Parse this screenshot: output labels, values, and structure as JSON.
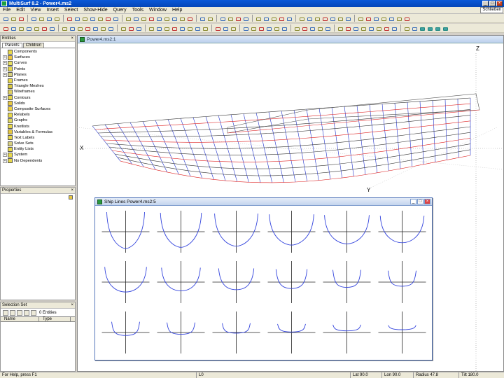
{
  "window": {
    "title": "MultiSurf 8.2 - Power4.ms2",
    "min_label": "_",
    "max_label": "□",
    "close_label": "×"
  },
  "menubar": {
    "items": [
      "File",
      "Edit",
      "View",
      "Insert",
      "Select",
      "Show-Hide",
      "Query",
      "Tools",
      "Window",
      "Help"
    ],
    "close_label": "Schließen"
  },
  "entities_panel": {
    "title": "Entities",
    "close_label": "×",
    "tabs": [
      "Parents",
      "Children"
    ],
    "items": [
      {
        "label": "Components",
        "expander": "",
        "color": "#e8d84a"
      },
      {
        "label": "Surfaces",
        "expander": "+",
        "color": "#f0c840"
      },
      {
        "label": "Curves",
        "expander": "+",
        "color": "#e8e060"
      },
      {
        "label": "Points",
        "expander": "+",
        "color": "#e8d84a"
      },
      {
        "label": "Planes",
        "expander": "+",
        "color": "#d8d080"
      },
      {
        "label": "Frames",
        "expander": "",
        "color": "#e8d84a"
      },
      {
        "label": "Triangle Meshes",
        "expander": "",
        "color": "#d8c840"
      },
      {
        "label": "Wireframes",
        "expander": "",
        "color": "#e0d060"
      },
      {
        "label": "Contours",
        "expander": "+",
        "color": "#e8d84a"
      },
      {
        "label": "Solids",
        "expander": "",
        "color": "#e8c840"
      },
      {
        "label": "Composite Surfaces",
        "expander": "",
        "color": "#f0d040"
      },
      {
        "label": "Relabels",
        "expander": "",
        "color": "#e8d84a"
      },
      {
        "label": "Graphs",
        "expander": "",
        "color": "#e0d860"
      },
      {
        "label": "Knotlists",
        "expander": "",
        "color": "#e8d84a"
      },
      {
        "label": "Variables & Formulas",
        "expander": "",
        "color": "#e8c840"
      },
      {
        "label": "Text Labels",
        "expander": "",
        "color": "#e8d84a"
      },
      {
        "label": "Solve Sets",
        "expander": "",
        "color": "#d8d080"
      },
      {
        "label": "Entity Lists",
        "expander": "",
        "color": "#e8d84a"
      },
      {
        "label": "System",
        "expander": "+",
        "color": "#e8d84a"
      },
      {
        "label": "No Dependents",
        "expander": "+",
        "color": "#e8d84a"
      }
    ]
  },
  "properties_panel": {
    "title": "Properties",
    "close_label": "×"
  },
  "selection_panel": {
    "title": "Selection Set",
    "close_label": "×",
    "count_label": "0 Entities",
    "columns": [
      "Name",
      "Type"
    ]
  },
  "main_view": {
    "title": "Power4.ms2:1",
    "axis_labels": {
      "x": "X",
      "y": "Y",
      "z": "Z"
    }
  },
  "ship_lines": {
    "title": "Ship Lines Power4.ms2:5",
    "min_label": "_",
    "max_label": "□",
    "close_label": "×"
  },
  "statusbar": {
    "help": "For Help, press F1",
    "layer": "L0",
    "lat": "Lat 90.0",
    "lon": "Lon 90.0",
    "radius": "Radius 47.8",
    "tilt": "Tilt 180.0"
  },
  "colors": {
    "hull_blue": "#2233cc",
    "hull_red": "#dd2222",
    "hull_dark": "#333333",
    "section_line": "#3344dd",
    "title_blue": "#0a58d8"
  }
}
